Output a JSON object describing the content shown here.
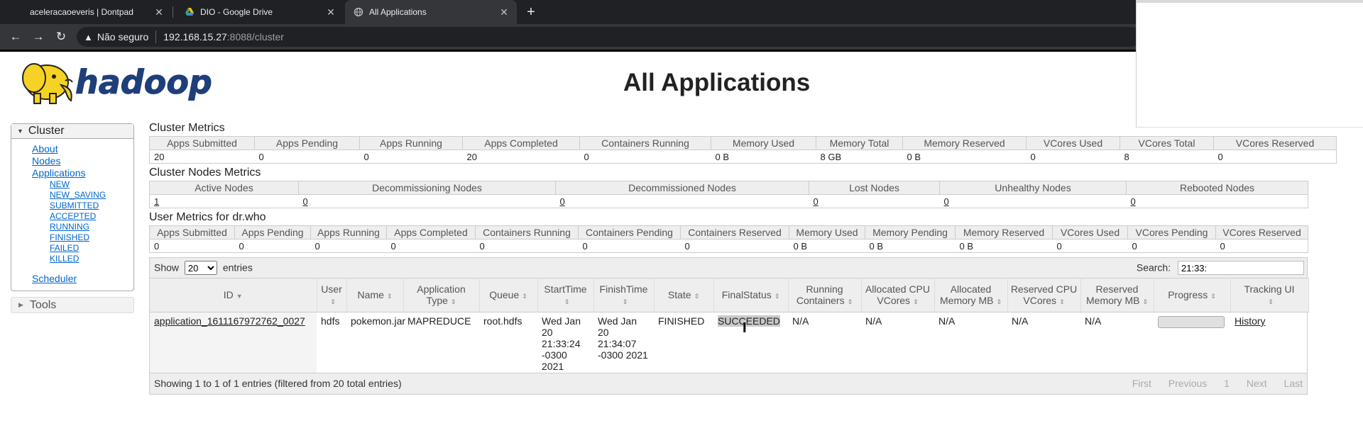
{
  "browser": {
    "tabs": [
      {
        "title": "aceleracaoeveris | Dontpad",
        "active": false
      },
      {
        "title": "DIO - Google Drive",
        "active": false
      },
      {
        "title": "All Applications",
        "active": true
      }
    ],
    "new_tab": "+",
    "security_label": "Não seguro",
    "url_host": "192.168.15.27",
    "url_path": ":8088/cluster"
  },
  "header": {
    "logo_text": "hadoop",
    "title": "All Applications"
  },
  "sidebar": {
    "cluster_label": "Cluster",
    "links": [
      "About",
      "Nodes",
      "Applications"
    ],
    "app_states": [
      "NEW",
      "NEW_SAVING",
      "SUBMITTED",
      "ACCEPTED",
      "RUNNING",
      "FINISHED",
      "FAILED",
      "KILLED"
    ],
    "scheduler": "Scheduler",
    "tools_label": "Tools"
  },
  "cluster_metrics": {
    "title": "Cluster Metrics",
    "headers": [
      "Apps Submitted",
      "Apps Pending",
      "Apps Running",
      "Apps Completed",
      "Containers Running",
      "Memory Used",
      "Memory Total",
      "Memory Reserved",
      "VCores Used",
      "VCores Total",
      "VCores Reserved"
    ],
    "values": [
      "20",
      "0",
      "0",
      "20",
      "0",
      "0 B",
      "8 GB",
      "0 B",
      "0",
      "8",
      "0"
    ]
  },
  "nodes_metrics": {
    "title": "Cluster Nodes Metrics",
    "headers": [
      "Active Nodes",
      "Decommissioning Nodes",
      "Decommissioned Nodes",
      "Lost Nodes",
      "Unhealthy Nodes",
      "Rebooted Nodes"
    ],
    "values": [
      "1",
      "0",
      "0",
      "0",
      "0",
      "0"
    ]
  },
  "user_metrics": {
    "title": "User Metrics for dr.who",
    "headers": [
      "Apps Submitted",
      "Apps Pending",
      "Apps Running",
      "Apps Completed",
      "Containers Running",
      "Containers Pending",
      "Containers Reserved",
      "Memory Used",
      "Memory Pending",
      "Memory Reserved",
      "VCores Used",
      "VCores Pending",
      "VCores Reserved"
    ],
    "values": [
      "0",
      "0",
      "0",
      "0",
      "0",
      "0",
      "0",
      "0 B",
      "0 B",
      "0 B",
      "0",
      "0",
      "0"
    ]
  },
  "apps_table": {
    "show_label": "Show",
    "page_size": "20",
    "entries_label": "entries",
    "search_label": "Search:",
    "search_value": "21:33:",
    "headers": {
      "id": "ID",
      "user": "User",
      "name": "Name",
      "app_type": "Application Type",
      "queue": "Queue",
      "start": "StartTime",
      "finish": "FinishTime",
      "state": "State",
      "final_status": "FinalStatus",
      "running_containers": "Running Containers",
      "alloc_cpu": "Allocated CPU VCores",
      "alloc_mem": "Allocated Memory MB",
      "res_cpu": "Reserved CPU VCores",
      "res_mem": "Reserved Memory MB",
      "progress": "Progress",
      "tracking": "Tracking UI"
    },
    "row": {
      "id": "application_1611167972762_0027",
      "user": "hdfs",
      "name": "pokemon.jar",
      "app_type": "MAPREDUCE",
      "queue": "root.hdfs",
      "start": "Wed Jan 20 21:33:24 -0300 2021",
      "finish": "Wed Jan 20 21:34:07 -0300 2021",
      "state": "FINISHED",
      "final_status": "SUCCEEDED",
      "running_containers": "N/A",
      "alloc_cpu": "N/A",
      "alloc_mem": "N/A",
      "res_cpu": "N/A",
      "res_mem": "N/A",
      "progress": 0,
      "tracking": "History"
    },
    "footer_info": "Showing 1 to 1 of 1 entries (filtered from 20 total entries)",
    "pager": [
      "First",
      "Previous",
      "1",
      "Next",
      "Last"
    ]
  }
}
